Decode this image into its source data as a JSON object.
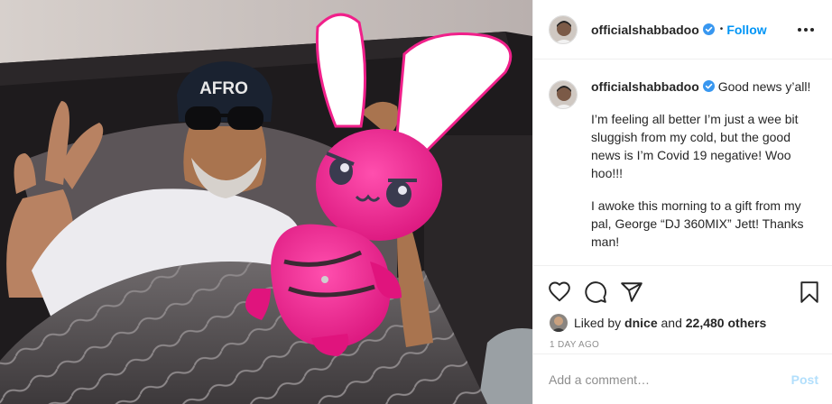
{
  "post": {
    "photo": {
      "cap_text": "AFRO"
    },
    "header": {
      "username": "officialshabbadoo",
      "follow_label": "Follow",
      "separator": "•"
    },
    "caption": {
      "username": "officialshabbadoo",
      "first_line": "Good news y’all!",
      "paragraph_1": "I’m feeling all better I’m just a wee bit sluggish from my cold, but the good news is I’m Covid 19 negative! Woo hoo!!!",
      "paragraph_2": "I awoke this morning to a gift from my pal, George “DJ 360MIX” Jett! Thanks man!"
    },
    "likes": {
      "prefix": "Liked by",
      "user": "dnice",
      "joiner": "and",
      "count_label": "22,480 others"
    },
    "timestamp": "1 DAY AGO",
    "comment_box": {
      "placeholder": "Add a comment…",
      "post_label": "Post"
    }
  },
  "colors": {
    "accent": "#0095f6",
    "verified": "#3897f0",
    "post_disabled": "#b2dffc",
    "toy_pink": "#f0208a"
  },
  "icons": [
    "verified-icon",
    "more-options-icon",
    "heart-icon",
    "comment-icon",
    "share-icon",
    "bookmark-icon"
  ]
}
